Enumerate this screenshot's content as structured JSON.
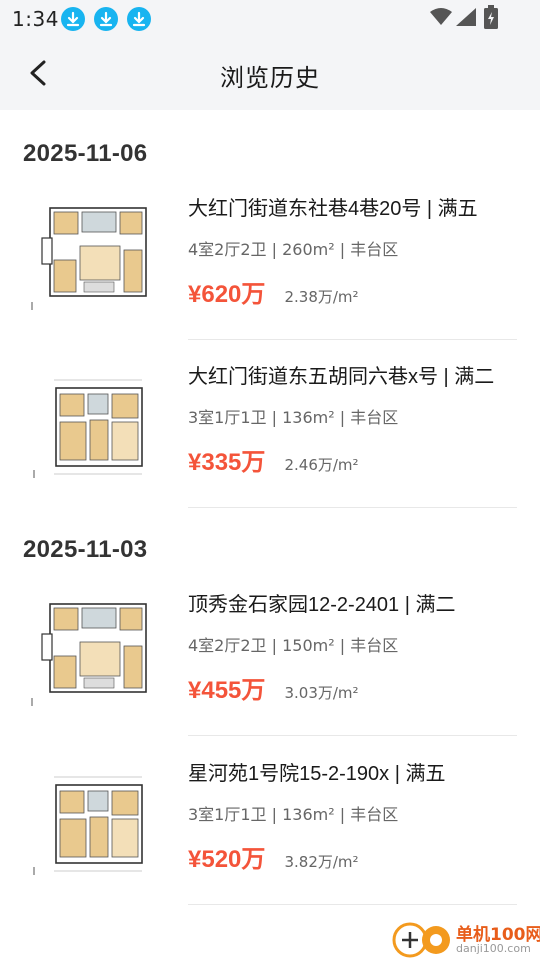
{
  "status_bar": {
    "time": "1:34"
  },
  "header": {
    "title": "浏览历史"
  },
  "groups": [
    {
      "date": "2025-11-06",
      "listings": [
        {
          "title": "大红门街道东社巷4巷20号 | 满五",
          "meta": "4室2厅2卫 | 260m² |  丰台区",
          "price": "¥620万",
          "unit_price": "2.38万/m²"
        },
        {
          "title": "大红门街道东五胡同六巷x号 | 满二",
          "meta": "3室1厅1卫 | 136m² |  丰台区",
          "price": "¥335万",
          "unit_price": "2.46万/m²"
        }
      ]
    },
    {
      "date": "2025-11-03",
      "listings": [
        {
          "title": "顶秀金石家园12-2-2401 | 满二",
          "meta": "4室2厅2卫 | 150m² |  丰台区",
          "price": "¥455万",
          "unit_price": "3.03万/m²"
        },
        {
          "title": "星河苑1号院15-2-190x | 满五",
          "meta": "3室1厅1卫 | 136m² |  丰台区",
          "price": "¥520万",
          "unit_price": "3.82万/m²"
        }
      ]
    }
  ],
  "watermark": {
    "brand": "单机100网",
    "url": "danji100.com"
  }
}
